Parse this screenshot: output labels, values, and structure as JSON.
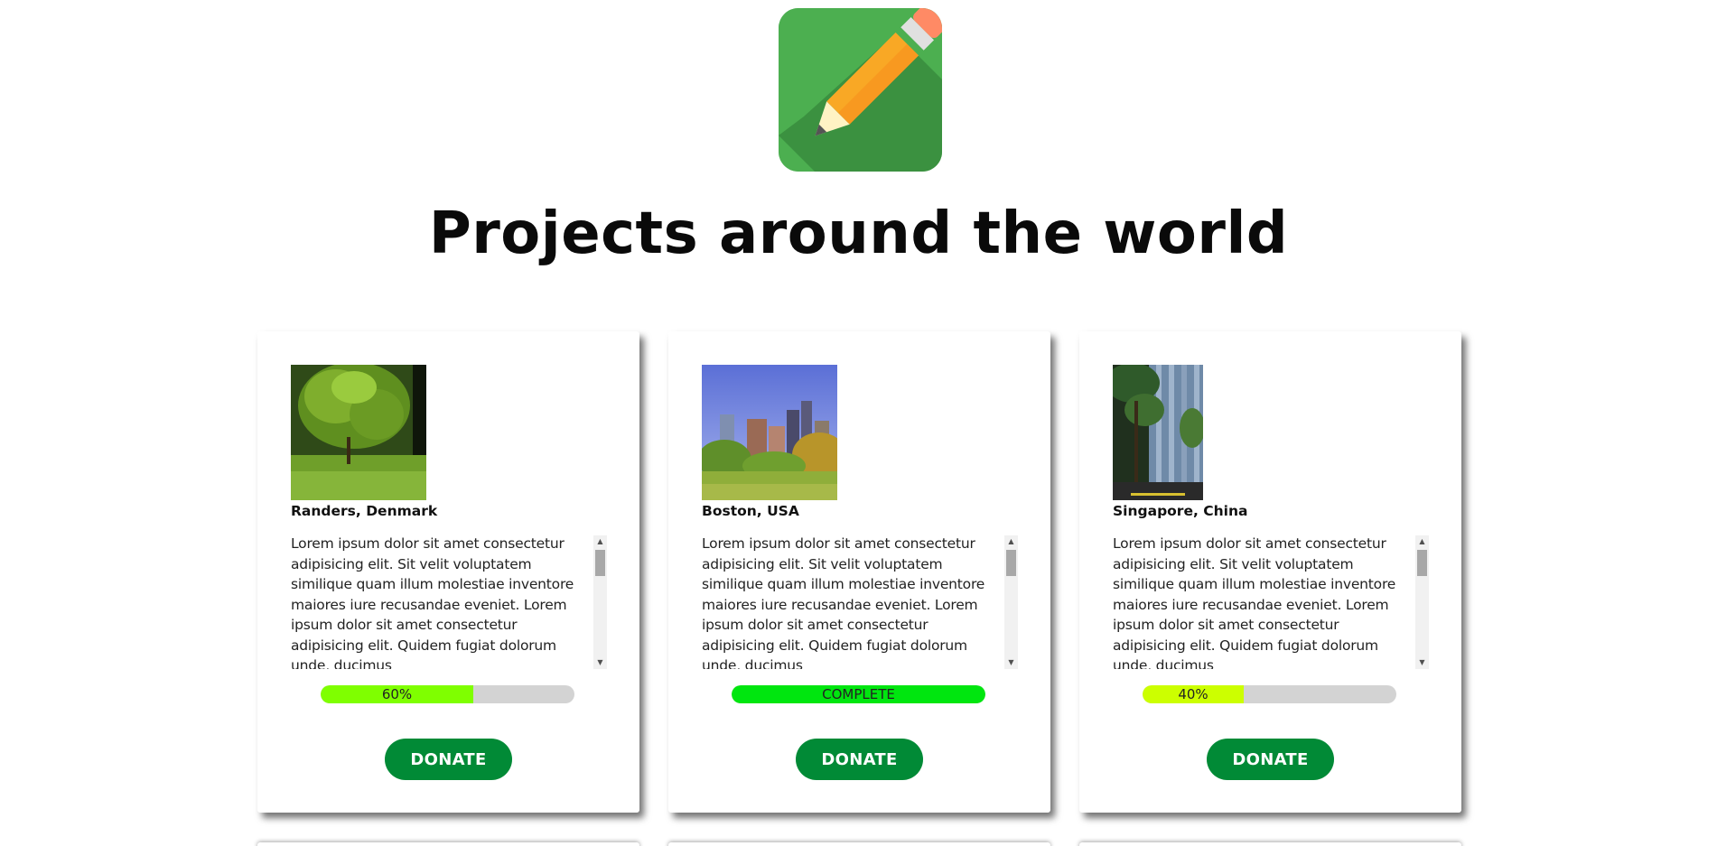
{
  "header": {
    "logo": {
      "icon": "pencil-icon",
      "background": "#4caf50"
    },
    "title": "Projects around the world"
  },
  "colors": {
    "donate_button": "#018a36",
    "progress_track": "#d3d3d3"
  },
  "projects": [
    {
      "city": "Randers, Denmark",
      "image": "forest-park-photo",
      "description": "Lorem ipsum dolor sit amet consectetur adipisicing elit. Sit velit voluptatem similique quam illum molestiae inventore maiores iure recusandae eveniet. Lorem ipsum dolor sit amet consectetur adipisicing elit. Quidem fugiat dolorum unde, ducimus",
      "progress": {
        "percent": 60,
        "label": "60%",
        "color": "#7fff00"
      },
      "donate_label": "DONATE"
    },
    {
      "city": "Boston, USA",
      "image": "city-park-skyline-photo",
      "description": "Lorem ipsum dolor sit amet consectetur adipisicing elit. Sit velit voluptatem similique quam illum molestiae inventore maiores iure recusandae eveniet. Lorem ipsum dolor sit amet consectetur adipisicing elit. Quidem fugiat dolorum unde, ducimus",
      "progress": {
        "percent": 100,
        "label": "COMPLETE",
        "color": "#00e60f"
      },
      "donate_label": "DONATE"
    },
    {
      "city": "Singapore, China",
      "image": "palm-trees-building-photo",
      "description": "Lorem ipsum dolor sit amet consectetur adipisicing elit. Sit velit voluptatem similique quam illum molestiae inventore maiores iure recusandae eveniet. Lorem ipsum dolor sit amet consectetur adipisicing elit. Quidem fugiat dolorum unde, ducimus",
      "progress": {
        "percent": 40,
        "label": "40%",
        "color": "#ccff00"
      },
      "donate_label": "DONATE"
    }
  ]
}
